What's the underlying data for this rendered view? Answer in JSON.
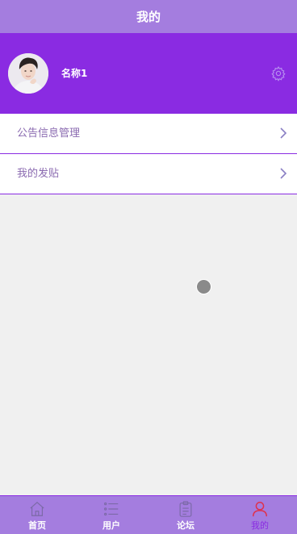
{
  "header": {
    "title": "我的"
  },
  "profile": {
    "name": "名称1",
    "avatar_icon": "person-avatar",
    "settings_icon": "gear-icon"
  },
  "menu": [
    {
      "label": "公告信息管理",
      "icon": "chevron-right-icon"
    },
    {
      "label": "我的发贴",
      "icon": "chevron-right-icon"
    }
  ],
  "tabs": [
    {
      "label": "首页",
      "icon": "home-icon",
      "active": false
    },
    {
      "label": "用户",
      "icon": "list-icon",
      "active": false
    },
    {
      "label": "论坛",
      "icon": "clipboard-icon",
      "active": false
    },
    {
      "label": "我的",
      "icon": "user-icon",
      "active": true
    }
  ],
  "colors": {
    "header_bg": "#a47ddf",
    "profile_bg": "#8a2be2",
    "accent": "#8a2be2",
    "active_tab_icon": "#e0304a",
    "menu_text": "#8a6ab0"
  }
}
